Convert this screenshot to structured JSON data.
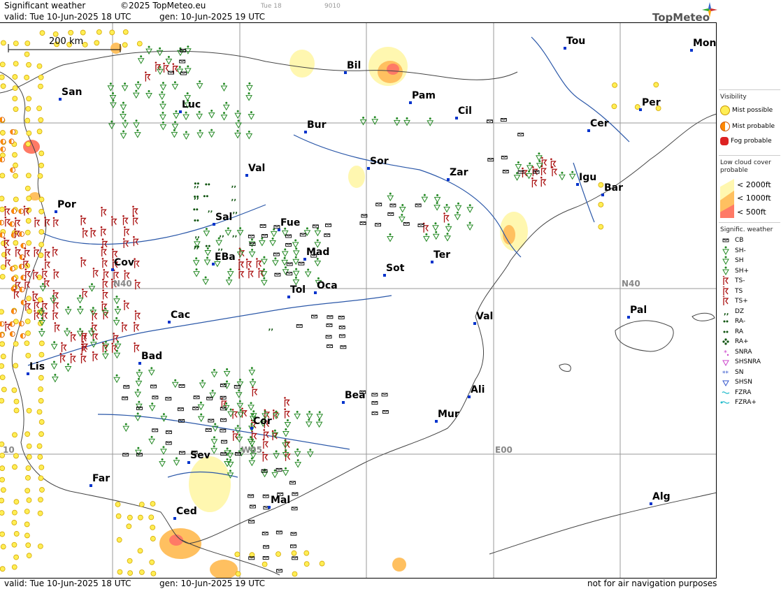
{
  "header": {
    "title": "Significant weather",
    "copyright": "©2025 TopMeteo.eu",
    "valid": "valid:  Tue  10-Jun-2025  18 UTC",
    "gen": "gen: 10-Jun-2025 19 UTC",
    "day_hint": "Tue 18",
    "code_hint": "9010",
    "logo": "TopMeteo"
  },
  "footer": {
    "valid": "valid:  Tue  10-Jun-2025  18 UTC",
    "gen": "gen: 10-Jun-2025 19 UTC",
    "note": "not for air navigation purposes"
  },
  "scale_bar": {
    "label": "200 km"
  },
  "grid_labels": {
    "n40_left": "N40",
    "n40_right": "N40",
    "w10": "10",
    "w05": "W05",
    "e00": "E00"
  },
  "cities": [
    {
      "id": "tou",
      "name": "Tou"
    },
    {
      "id": "mon",
      "name": "Mon"
    },
    {
      "id": "san",
      "name": "San"
    },
    {
      "id": "bil",
      "name": "Bil"
    },
    {
      "id": "pam",
      "name": "Pam"
    },
    {
      "id": "cil",
      "name": "Cil"
    },
    {
      "id": "luc",
      "name": "Luc"
    },
    {
      "id": "bur",
      "name": "Bur"
    },
    {
      "id": "per",
      "name": "Per"
    },
    {
      "id": "cer",
      "name": "Cer"
    },
    {
      "id": "sor",
      "name": "Sor"
    },
    {
      "id": "val1",
      "name": "Val"
    },
    {
      "id": "zar",
      "name": "Zar"
    },
    {
      "id": "igu",
      "name": "Igu"
    },
    {
      "id": "bar",
      "name": "Bar"
    },
    {
      "id": "por",
      "name": "Por"
    },
    {
      "id": "sal",
      "name": "Sal"
    },
    {
      "id": "fue",
      "name": "Fue"
    },
    {
      "id": "mad",
      "name": "Mad"
    },
    {
      "id": "ter",
      "name": "Ter"
    },
    {
      "id": "cov",
      "name": "Cov"
    },
    {
      "id": "eba",
      "name": "EBa"
    },
    {
      "id": "sot",
      "name": "Sot"
    },
    {
      "id": "tol",
      "name": "Tol"
    },
    {
      "id": "oca",
      "name": "Oca"
    },
    {
      "id": "pal",
      "name": "Pal"
    },
    {
      "id": "cac",
      "name": "Cac"
    },
    {
      "id": "val2",
      "name": "Val"
    },
    {
      "id": "bad",
      "name": "Bad"
    },
    {
      "id": "lis",
      "name": "Lis"
    },
    {
      "id": "ali",
      "name": "Ali"
    },
    {
      "id": "bea",
      "name": "Bea"
    },
    {
      "id": "mur",
      "name": "Mur"
    },
    {
      "id": "cor",
      "name": "Cor"
    },
    {
      "id": "sev",
      "name": "Sev"
    },
    {
      "id": "far",
      "name": "Far"
    },
    {
      "id": "mal",
      "name": "Mal"
    },
    {
      "id": "alg",
      "name": "Alg"
    },
    {
      "id": "ced",
      "name": "Ced"
    }
  ],
  "legend": {
    "visibility_title": "Visibility",
    "mist_possible": "Mist possible",
    "mist_probable": "Mist probable",
    "fog_probable": "Fog probable",
    "lowcloud_title_1": "Low cloud cover",
    "lowcloud_title_2": "probable",
    "lc_2000": "< 2000ft",
    "lc_1000": "< 1000ft",
    "lc_500": "<   500ft",
    "sig_title": "Signific. weather",
    "items": [
      "CB",
      "SH-",
      "SH",
      "SH+",
      "TS-",
      "TS",
      "TS+",
      "DZ",
      "RA-",
      "RA",
      "RA+",
      "SNRA",
      "SHSNRA",
      "SN",
      "SHSN",
      "FZRA",
      "FZRA+"
    ],
    "colors": {
      "mist_possible": "#ffee55",
      "mist_probable": "#ff8800",
      "fog_probable": "#dd2222",
      "lc_2000": "#fff7b0",
      "lc_1000": "#ffc060",
      "lc_500": "#ff7a66",
      "shower": "#228822",
      "thunder": "#aa1111",
      "snow": "#cc44cc",
      "snowblue": "#3355cc",
      "fz": "#22bbcc"
    }
  }
}
